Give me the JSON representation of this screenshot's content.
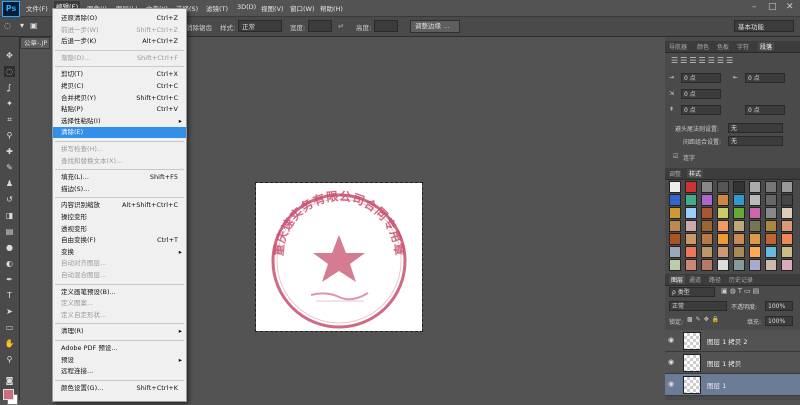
{
  "app": {
    "logo": "Ps"
  },
  "menubar": {
    "items": [
      "文件(F)",
      "编辑(E)",
      "图像(I)",
      "图层(L)",
      "文字(Y)",
      "选择(S)",
      "滤镜(T)",
      "3D(D)",
      "视图(V)",
      "窗口(W)",
      "帮助(H)"
    ],
    "active": "编辑(E)",
    "win_min": "–",
    "win_max": "□",
    "win_close": "✕"
  },
  "options": {
    "anti_alias": "消除锯齿",
    "style_label": "样式:",
    "style_value": "正常",
    "width_label": "宽度:",
    "height_label": "高度:",
    "refine_button": "调整边缘 ...",
    "workspace": "基本功能"
  },
  "document": {
    "tab": "公章-.JP"
  },
  "edit_menu": [
    {
      "label": "还原清除(O)",
      "shortcut": "Ctrl+Z",
      "disabled": false
    },
    {
      "label": "前进一步(W)",
      "shortcut": "Shift+Ctrl+Z",
      "disabled": true
    },
    {
      "label": "后退一步(K)",
      "shortcut": "Alt+Ctrl+Z",
      "disabled": false
    },
    {
      "sep": true
    },
    {
      "label": "渐隐(D)...",
      "shortcut": "Shift+Ctrl+F",
      "disabled": true
    },
    {
      "sep": true
    },
    {
      "label": "剪切(T)",
      "shortcut": "Ctrl+X",
      "disabled": false
    },
    {
      "label": "拷贝(C)",
      "shortcut": "Ctrl+C",
      "disabled": false
    },
    {
      "label": "合并拷贝(Y)",
      "shortcut": "Shift+Ctrl+C",
      "disabled": false
    },
    {
      "label": "粘贴(P)",
      "shortcut": "Ctrl+V",
      "disabled": false
    },
    {
      "label": "选择性粘贴(I)",
      "submenu": true,
      "disabled": false
    },
    {
      "label": "清除(E)",
      "highlight": true,
      "disabled": false
    },
    {
      "sep": true
    },
    {
      "label": "拼写检查(H)...",
      "disabled": true
    },
    {
      "label": "查找和替换文本(X)...",
      "disabled": true
    },
    {
      "sep": true
    },
    {
      "label": "填充(L)...",
      "shortcut": "Shift+F5",
      "disabled": false
    },
    {
      "label": "描边(S)...",
      "disabled": false
    },
    {
      "sep": true
    },
    {
      "label": "内容识别缩放",
      "shortcut": "Alt+Shift+Ctrl+C",
      "disabled": false
    },
    {
      "label": "操控变形",
      "disabled": false
    },
    {
      "label": "透视变形",
      "disabled": false
    },
    {
      "label": "自由变换(F)",
      "shortcut": "Ctrl+T",
      "disabled": false
    },
    {
      "label": "变换",
      "submenu": true,
      "disabled": false
    },
    {
      "label": "自动对齐图层...",
      "disabled": true
    },
    {
      "label": "自动混合图层...",
      "disabled": true
    },
    {
      "sep": true
    },
    {
      "label": "定义画笔预设(B)...",
      "disabled": false
    },
    {
      "label": "定义图案...",
      "disabled": true
    },
    {
      "label": "定义自定形状...",
      "disabled": true
    },
    {
      "sep": true
    },
    {
      "label": "清理(R)",
      "submenu": true,
      "disabled": false
    },
    {
      "sep": true
    },
    {
      "label": "Adobe PDF 预设...",
      "disabled": false
    },
    {
      "label": "预设",
      "submenu": true,
      "disabled": false
    },
    {
      "label": "远程连接...",
      "disabled": false
    },
    {
      "sep": true
    },
    {
      "label": "颜色设置(G)...",
      "shortcut": "Shift+Ctrl+K",
      "disabled": false
    }
  ],
  "panels": {
    "top_tabs": [
      "导航器",
      "颜色",
      "色板",
      "字符",
      "段落"
    ],
    "indent_value_1": "0 点",
    "indent_value_2": "0 点",
    "indent_value_3": "0 点",
    "indent_value_4": "0 点",
    "hyphen_label": "避头尾法则设置:",
    "hyphen_value": "无",
    "spacing_label": "间距组合设置:",
    "spacing_value": "无",
    "ligature_label": "连字",
    "style_tabs": [
      "调整",
      "样式"
    ],
    "layer_tabs": [
      "图层",
      "通道",
      "路径",
      "历史记录"
    ],
    "kind_label": "类型",
    "blend_mode": "正常",
    "opacity_label": "不透明度:",
    "opacity_value": "100%",
    "lock_label": "锁定:",
    "fill_label": "填充:",
    "fill_value": "100%",
    "layers": [
      {
        "name": "图层 1 拷贝 2",
        "selected": false
      },
      {
        "name": "图层 1 拷贝",
        "selected": false
      },
      {
        "name": "图层 1",
        "selected": true
      }
    ]
  },
  "stamp": {
    "text": "重庆速实务有限公司合同专用章",
    "color": "#c8506e"
  }
}
